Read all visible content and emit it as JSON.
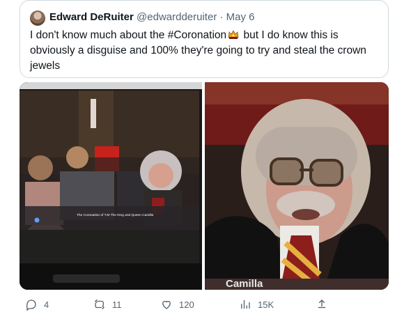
{
  "tweet": {
    "author_name": "Edward DeRuiter",
    "handle": "@edwardderuiter",
    "separator": "·",
    "date": "May 6",
    "text_part1": "I don't know much about the #Coronation",
    "text_part2": " but I do know this is obviously a disguise and 100% they're going to try and steal the crown jewels",
    "emoji": "crown-icon"
  },
  "media": {
    "left_photo_caption": "The Coronation of T.M The King and Queen Camilla",
    "right_photo_caption": "Camilla"
  },
  "actions": {
    "replies": "4",
    "retweets": "11",
    "likes": "120",
    "views": "15K"
  },
  "colors": {
    "text": "#0f1419",
    "secondary": "#536471",
    "border": "#cfd9de"
  }
}
